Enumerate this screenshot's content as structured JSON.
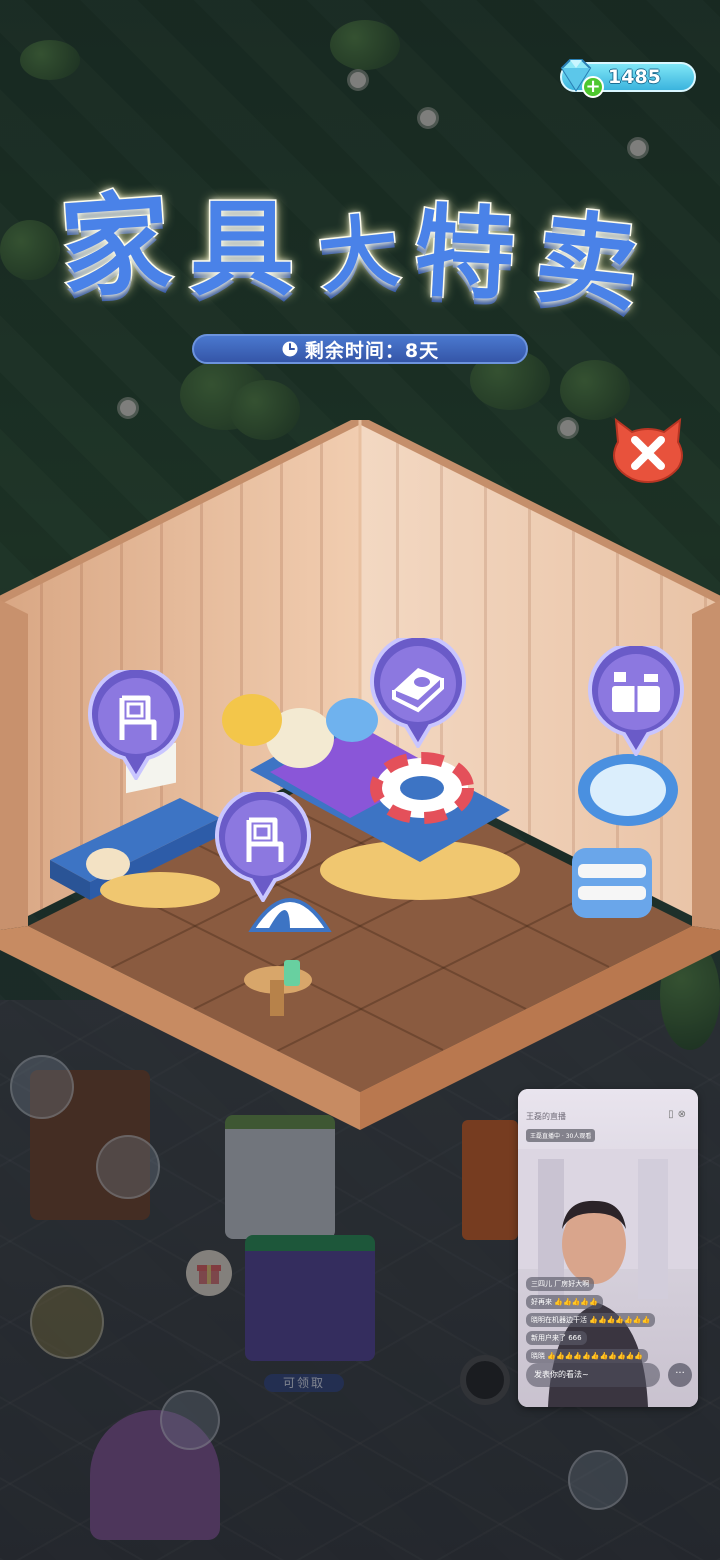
{
  "hud": {
    "gem_count": "1485",
    "gem_icon": "diamond-icon",
    "add_icon": "plus-icon"
  },
  "event": {
    "title_chars": [
      "家",
      "具",
      "大",
      "特",
      "卖"
    ],
    "timer_label": "剩余时间：8天",
    "timer_icon": "clock-icon",
    "close_icon": "close-icon"
  },
  "room": {
    "furniture_slots": [
      {
        "name": "bench",
        "icon": "chair-icon"
      },
      {
        "name": "bed",
        "icon": "bed-icon"
      },
      {
        "name": "dresser",
        "icon": "cabinet-icon"
      },
      {
        "name": "lamp-table",
        "icon": "chair-icon"
      }
    ]
  },
  "live_stream": {
    "title": "王磊的直播",
    "viewers": "王磊直播中 · 30人观看",
    "comments": [
      "三四儿 厂房好大啊",
      "好再来 👍👍👍👍👍",
      "晓明在机器边干活 👍👍👍👍👍👍👍",
      "新用户来了 666",
      "晓晓 👍👍👍👍👍👍👍👍👍👍👍"
    ],
    "input_placeholder": "发表你的看法~",
    "more_label": "···"
  },
  "world": {
    "claim_label": "可领取"
  },
  "colors": {
    "title_blue": "#4a82e8",
    "timer_bar": "#3556a8",
    "close_red": "#e8523c",
    "gem_blue": "#3bb4de",
    "bubble_purple": "#7a6ad8"
  }
}
